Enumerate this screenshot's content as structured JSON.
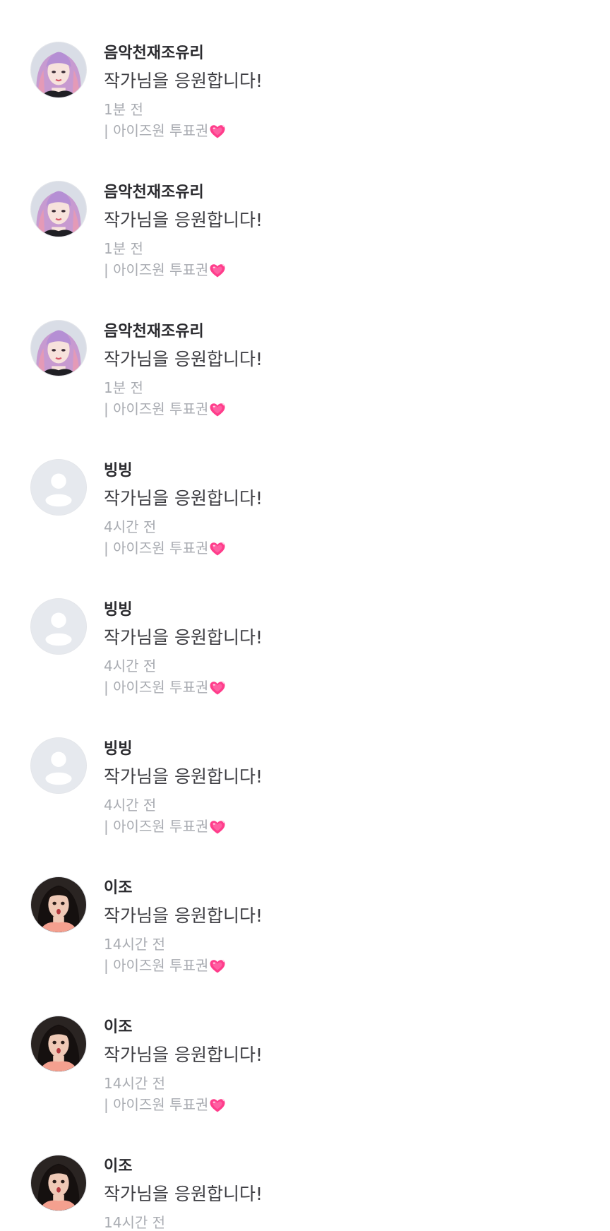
{
  "gift_icon": "growing-heart-icon",
  "colors": {
    "nickname": "#2a2a2e",
    "message": "#3d3d42",
    "meta": "#a8abb1",
    "heart": "#ff3d8b",
    "default_avatar_bg": "#e6e9ee"
  },
  "comments": [
    {
      "nickname": "음악천재조유리",
      "message": "작가님을 응원합니다!",
      "time": "1분 전",
      "gift": "| 아이즈원 투표권",
      "avatar": "purple-hair-profile-photo"
    },
    {
      "nickname": "음악천재조유리",
      "message": "작가님을 응원합니다!",
      "time": "1분 전",
      "gift": "| 아이즈원 투표권",
      "avatar": "purple-hair-profile-photo"
    },
    {
      "nickname": "음악천재조유리",
      "message": "작가님을 응원합니다!",
      "time": "1분 전",
      "gift": "| 아이즈원 투표권",
      "avatar": "purple-hair-profile-photo"
    },
    {
      "nickname": "빙빙",
      "message": "작가님을 응원합니다!",
      "time": "4시간 전",
      "gift": "| 아이즈원 투표권",
      "avatar": "default-user-icon"
    },
    {
      "nickname": "빙빙",
      "message": "작가님을 응원합니다!",
      "time": "4시간 전",
      "gift": "| 아이즈원 투표권",
      "avatar": "default-user-icon"
    },
    {
      "nickname": "빙빙",
      "message": "작가님을 응원합니다!",
      "time": "4시간 전",
      "gift": "| 아이즈원 투표권",
      "avatar": "default-user-icon"
    },
    {
      "nickname": "이조",
      "message": "작가님을 응원합니다!",
      "time": "14시간 전",
      "gift": "| 아이즈원 투표권",
      "avatar": "dark-hair-profile-photo"
    },
    {
      "nickname": "이조",
      "message": "작가님을 응원합니다!",
      "time": "14시간 전",
      "gift": "| 아이즈원 투표권",
      "avatar": "dark-hair-profile-photo"
    },
    {
      "nickname": "이조",
      "message": "작가님을 응원합니다!",
      "time": "14시간 전",
      "gift": "",
      "avatar": "dark-hair-profile-photo"
    }
  ]
}
